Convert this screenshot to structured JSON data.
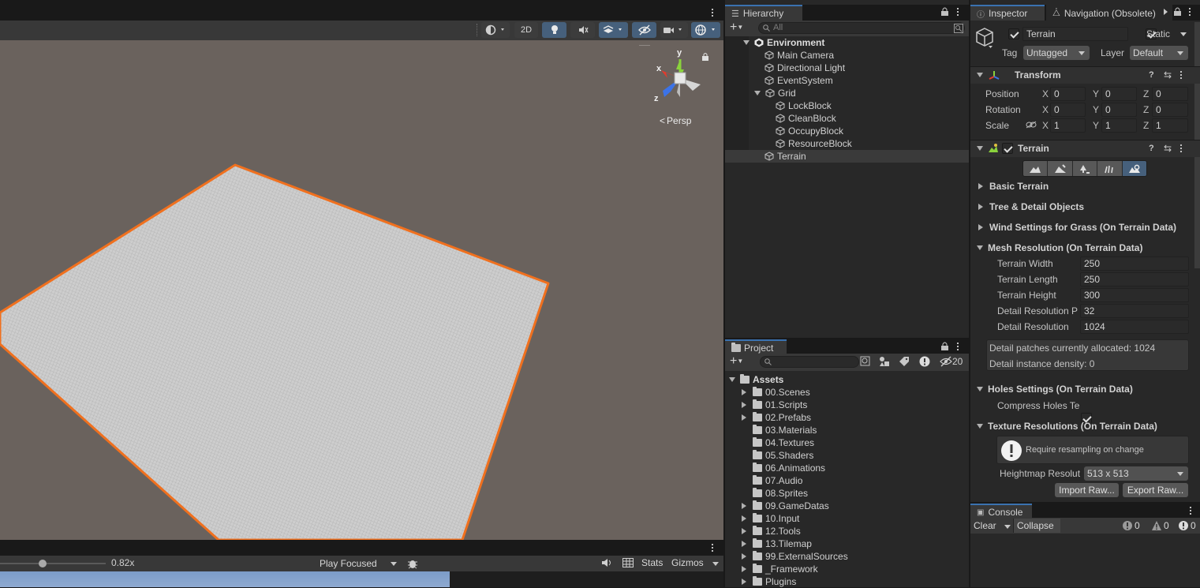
{
  "scene": {
    "toolbar": {
      "mode_2d": "2D"
    },
    "gizmo": {
      "axis_y": "y",
      "axis_x": "x",
      "axis_z": "z",
      "projection": "Persp"
    },
    "game_bar": {
      "scale_value": "0.82x",
      "play_mode": "Play Focused",
      "stats": "Stats",
      "gizmos": "Gizmos"
    }
  },
  "hierarchy": {
    "tab": "Hierarchy",
    "search_placeholder": "All",
    "items": [
      {
        "label": "Environment",
        "depth": 0,
        "root": true
      },
      {
        "label": "Main Camera",
        "depth": 1
      },
      {
        "label": "Directional Light",
        "depth": 1
      },
      {
        "label": "EventSystem",
        "depth": 1
      },
      {
        "label": "Grid",
        "depth": 1,
        "expanded": true
      },
      {
        "label": "LockBlock",
        "depth": 2
      },
      {
        "label": "CleanBlock",
        "depth": 2
      },
      {
        "label": "OccupyBlock",
        "depth": 2
      },
      {
        "label": "ResourceBlock",
        "depth": 2
      },
      {
        "label": "Terrain",
        "depth": 1,
        "selected": true
      }
    ]
  },
  "project": {
    "tab": "Project",
    "hidden_count": "20",
    "root": "Assets",
    "folders": [
      {
        "label": "00.Scenes",
        "expandable": true
      },
      {
        "label": "01.Scripts",
        "expandable": true
      },
      {
        "label": "02.Prefabs",
        "expandable": true
      },
      {
        "label": "03.Materials",
        "expandable": false
      },
      {
        "label": "04.Textures",
        "expandable": false
      },
      {
        "label": "05.Shaders",
        "expandable": false
      },
      {
        "label": "06.Animations",
        "expandable": false
      },
      {
        "label": "07.Audio",
        "expandable": false
      },
      {
        "label": "08.Sprites",
        "expandable": false
      },
      {
        "label": "09.GameDatas",
        "expandable": true
      },
      {
        "label": "10.Input",
        "expandable": true
      },
      {
        "label": "12.Tools",
        "expandable": true
      },
      {
        "label": "13.Tilemap",
        "expandable": true
      },
      {
        "label": "99.ExternalSources",
        "expandable": true
      },
      {
        "label": "_Framework",
        "expandable": true
      },
      {
        "label": "Plugins",
        "expandable": true
      }
    ]
  },
  "inspector": {
    "tab": "Inspector",
    "tab2": "Navigation (Obsolete)",
    "object_name": "Terrain",
    "static_label": "Static",
    "tag_label": "Tag",
    "tag_value": "Untagged",
    "layer_label": "Layer",
    "layer_value": "Default",
    "transform": {
      "title": "Transform",
      "rows": [
        {
          "label": "Position",
          "x": "0",
          "y": "0",
          "z": "0"
        },
        {
          "label": "Rotation",
          "x": "0",
          "y": "0",
          "z": "0"
        },
        {
          "label": "Scale",
          "x": "1",
          "y": "1",
          "z": "1"
        }
      ],
      "ax": "X",
      "ay": "Y",
      "az": "Z"
    },
    "terrain": {
      "title": "Terrain",
      "sections": {
        "basic": "Basic Terrain",
        "tree": "Tree & Detail Objects",
        "wind": "Wind Settings for Grass (On Terrain Data)",
        "mesh": "Mesh Resolution (On Terrain Data)",
        "holes": "Holes Settings (On Terrain Data)",
        "texture": "Texture Resolutions (On Terrain Data)"
      },
      "mesh_rows": [
        {
          "label": "Terrain Width",
          "value": "250"
        },
        {
          "label": "Terrain Length",
          "value": "250"
        },
        {
          "label": "Terrain Height",
          "value": "300"
        },
        {
          "label": "Detail Resolution P",
          "value": "32"
        },
        {
          "label": "Detail Resolution",
          "value": "1024"
        }
      ],
      "info_allocated": "Detail patches currently allocated: 1024",
      "info_density": "Detail instance density: 0",
      "compress_holes": "Compress Holes Te",
      "resample_warning": "Require resampling on change",
      "heightmap_label": "Heightmap Resolut",
      "heightmap_value": "513 x 513",
      "import_raw": "Import Raw...",
      "export_raw": "Export Raw..."
    }
  },
  "console": {
    "tab": "Console",
    "clear": "Clear",
    "collapse": "Collapse",
    "log_count": "0",
    "warn_count": "0",
    "error_count": "0"
  },
  "colors": {
    "selection_outline": "#f0701e",
    "accent_tab": "#3a72b0",
    "scene_bg": "#6a625d"
  }
}
